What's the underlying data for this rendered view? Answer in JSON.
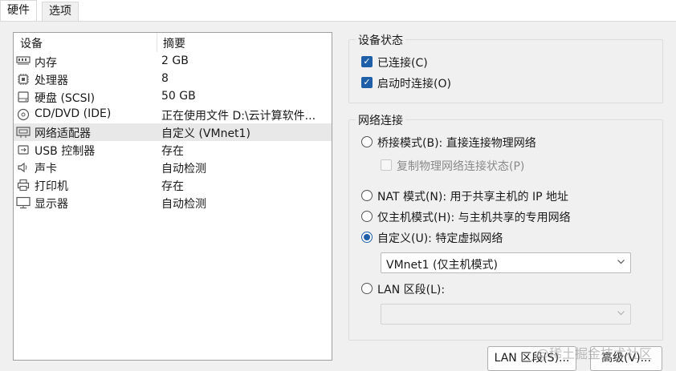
{
  "tabs": [
    {
      "label": "硬件",
      "active": true
    },
    {
      "label": "选项",
      "active": false
    }
  ],
  "device_list": {
    "col_device": "设备",
    "col_summary": "摘要",
    "rows": [
      {
        "icon": "memory-icon",
        "name": "内存",
        "summary": "2 GB"
      },
      {
        "icon": "processor-icon",
        "name": "处理器",
        "summary": "8"
      },
      {
        "icon": "hard-disk-icon",
        "name": "硬盘 (SCSI)",
        "summary": "50 GB"
      },
      {
        "icon": "cd-dvd-icon",
        "name": "CD/DVD (IDE)",
        "summary": "正在使用文件 D:\\云计算软件..."
      },
      {
        "icon": "network-adapter-icon",
        "name": "网络适配器",
        "summary": "自定义 (VMnet1)",
        "selected": true
      },
      {
        "icon": "usb-icon",
        "name": "USB 控制器",
        "summary": "存在"
      },
      {
        "icon": "sound-icon",
        "name": "声卡",
        "summary": "自动检测"
      },
      {
        "icon": "printer-icon",
        "name": "打印机",
        "summary": "存在"
      },
      {
        "icon": "display-icon",
        "name": "显示器",
        "summary": "自动检测"
      }
    ]
  },
  "device_status": {
    "title": "设备状态",
    "connected": {
      "label": "已连接(C)",
      "checked": true
    },
    "connect_at_power_on": {
      "label": "启动时连接(O)",
      "checked": true
    }
  },
  "network_connection": {
    "title": "网络连接",
    "bridged": {
      "label": "桥接模式(B): 直接连接物理网络",
      "selected": false
    },
    "replicate": {
      "label": "复制物理网络连接状态(P)",
      "checked": false,
      "disabled": true
    },
    "nat": {
      "label": "NAT 模式(N): 用于共享主机的 IP 地址",
      "selected": false
    },
    "host_only": {
      "label": "仅主机模式(H): 与主机共享的专用网络",
      "selected": false
    },
    "custom": {
      "label": "自定义(U): 特定虚拟网络",
      "selected": true
    },
    "custom_select_value": "VMnet1 (仅主机模式)",
    "lan_segment": {
      "label": "LAN 区段(L):",
      "selected": false
    },
    "lan_select_value": ""
  },
  "buttons": {
    "lan_segments": "LAN 区段(S)...",
    "advanced": "高级(V)..."
  },
  "watermark": "@稀土掘金技术社区",
  "colors": {
    "accent": "#1f5fa8",
    "selected_row": "#e8e8e8"
  }
}
